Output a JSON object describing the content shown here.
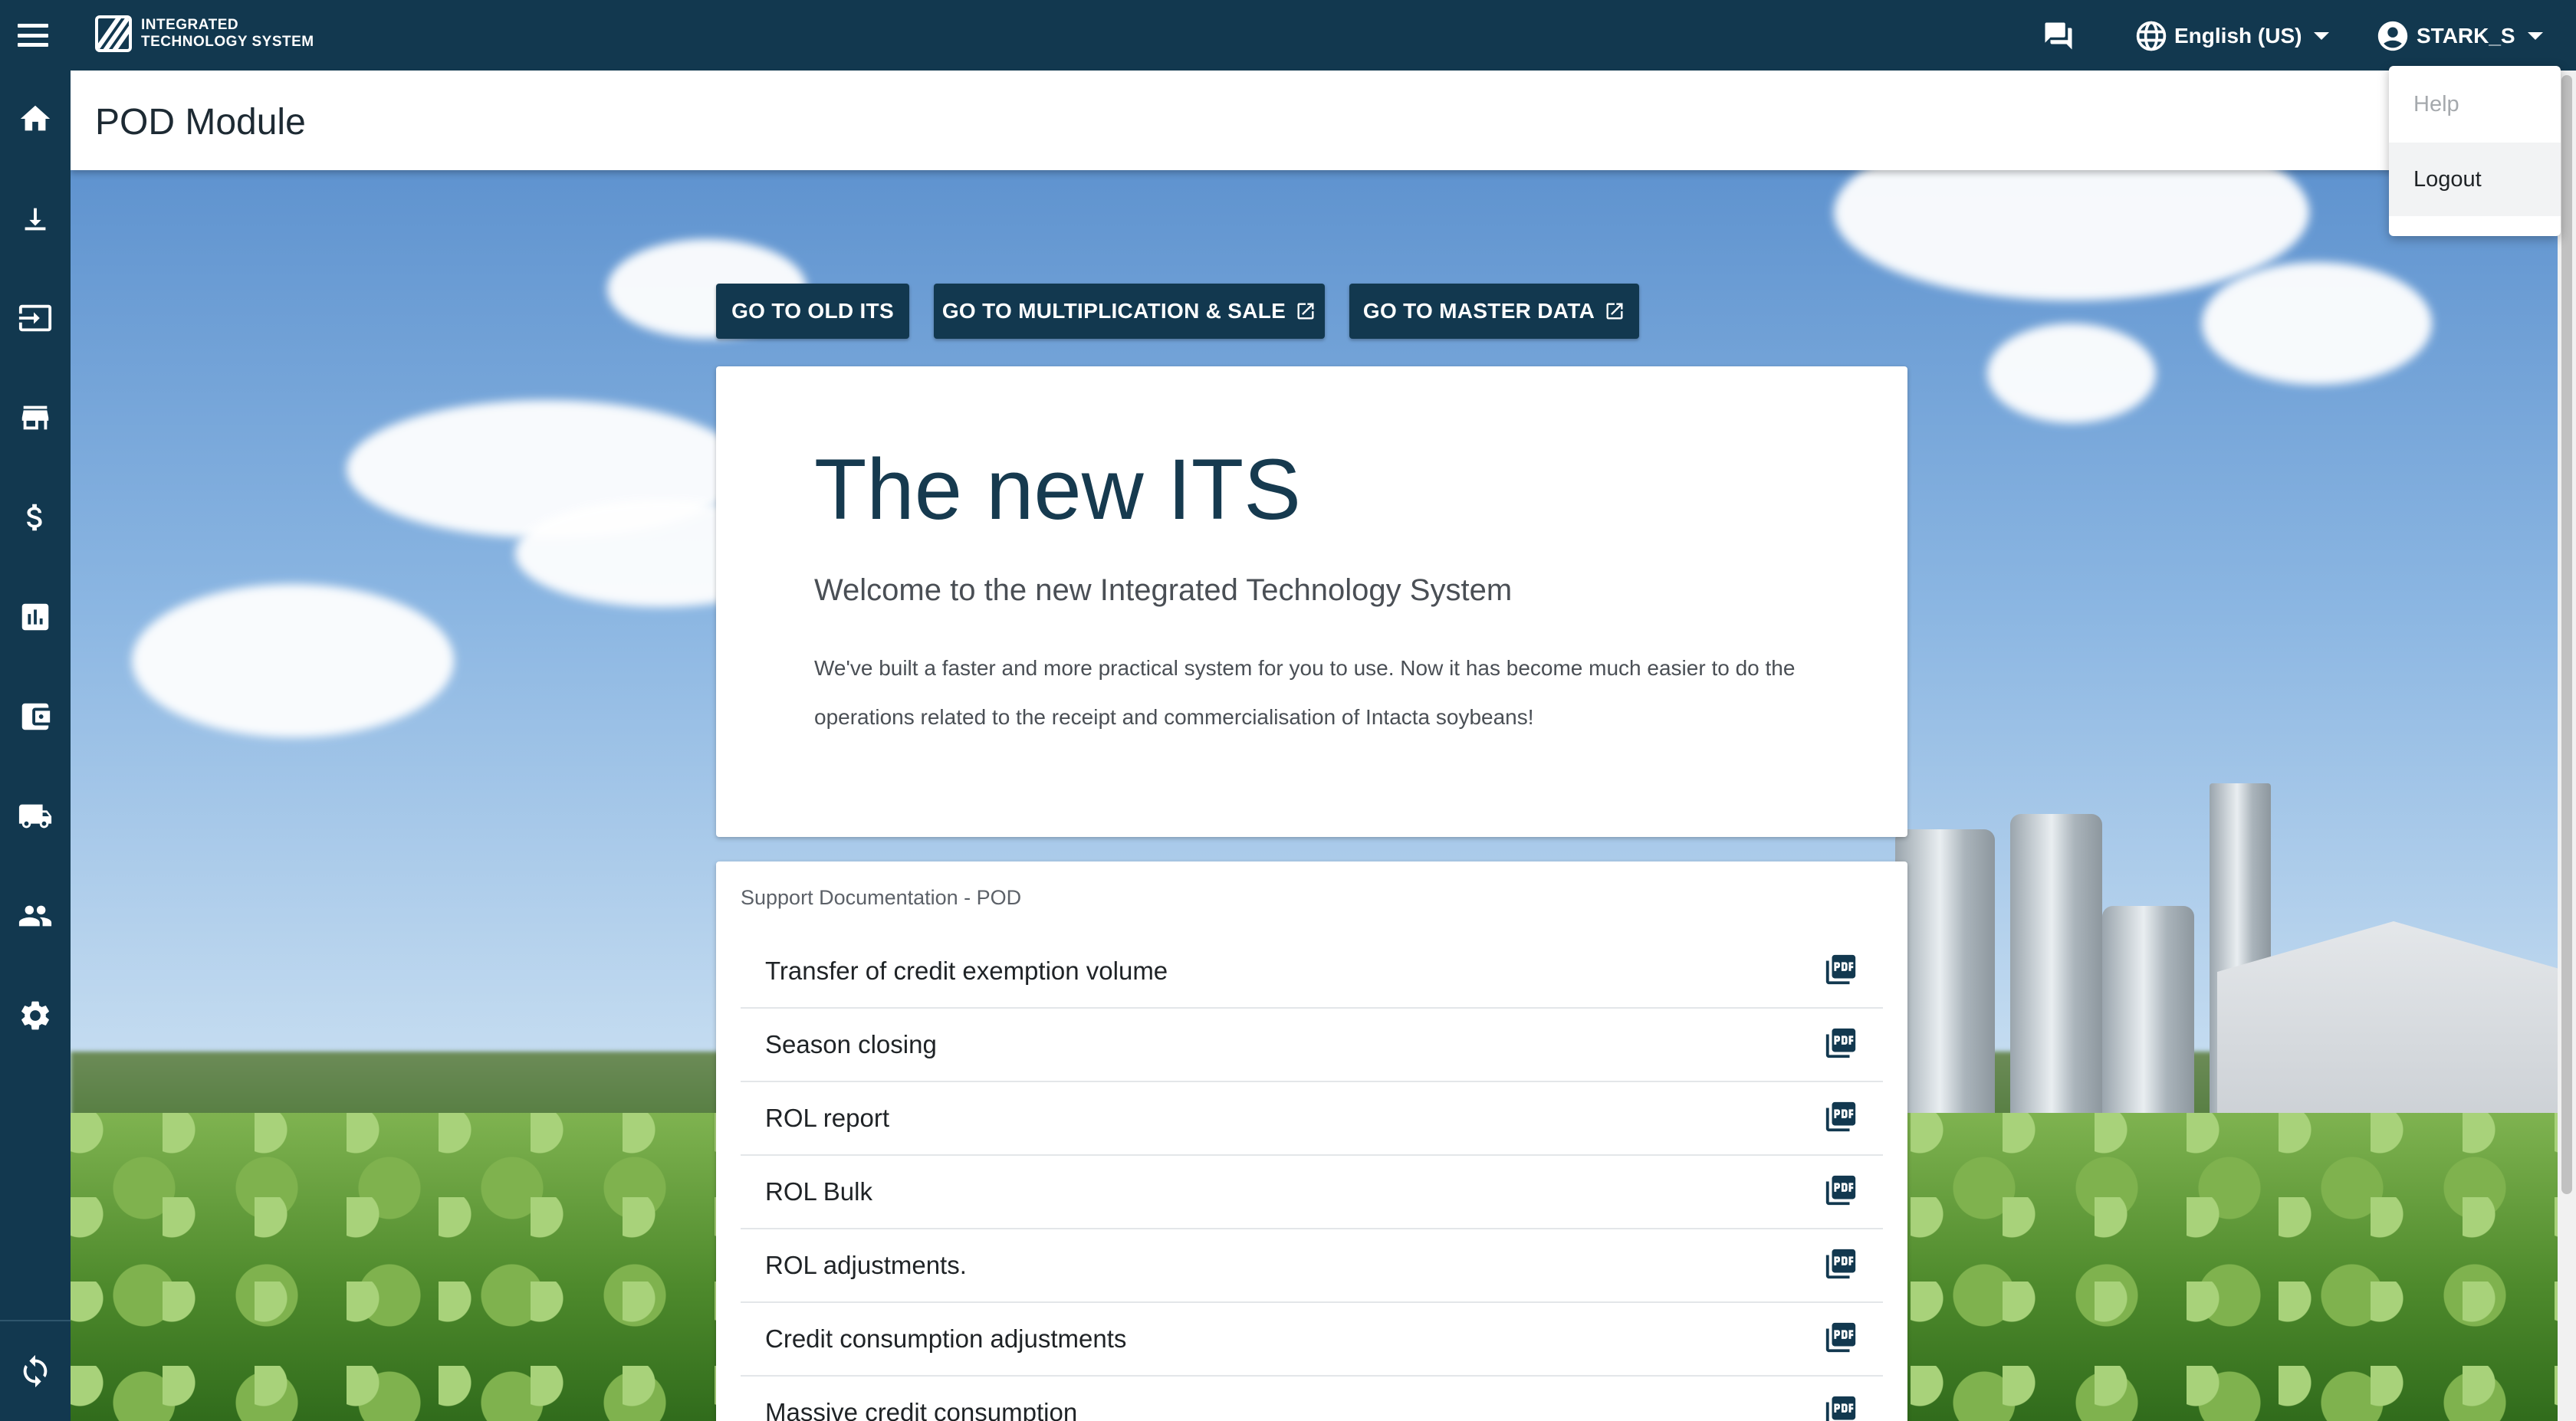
{
  "topbar": {
    "logo_line1": "INTEGRATED",
    "logo_line2": "TECHNOLOGY SYSTEM",
    "language": "English (US)",
    "username": "STARK_S",
    "icons": [
      "menu-icon",
      "chat-icon",
      "globe-icon",
      "account-circle-icon"
    ]
  },
  "sidebar": {
    "items": [
      {
        "icon": "home-icon"
      },
      {
        "icon": "download-icon"
      },
      {
        "icon": "input-icon"
      },
      {
        "icon": "store-icon"
      },
      {
        "icon": "dollar-icon"
      },
      {
        "icon": "bar-chart-icon"
      },
      {
        "icon": "wallet-icon"
      },
      {
        "icon": "truck-icon"
      },
      {
        "icon": "people-icon"
      },
      {
        "icon": "gear-icon"
      },
      {
        "icon": "sync-icon"
      }
    ]
  },
  "page": {
    "title": "POD Module"
  },
  "buttons": {
    "old_its": "GO TO OLD ITS",
    "multiplication_sale": "GO TO MULTIPLICATION & SALE",
    "master_data": "GO TO MASTER DATA"
  },
  "welcome": {
    "title": "The new ITS",
    "subtitle": "Welcome to the new Integrated Technology System",
    "body": "We've built a faster and more practical system for you to use. Now it has become much easier to do the operations related to the receipt and commercialisation of Intacta soybeans!"
  },
  "docs": {
    "heading": "Support Documentation - POD",
    "items": [
      "Transfer of credit exemption volume",
      "Season closing",
      "ROL report",
      "ROL Bulk",
      "ROL adjustments.",
      "Credit consumption adjustments",
      "Massive credit consumption"
    ]
  },
  "user_menu": {
    "help": "Help",
    "logout": "Logout"
  },
  "colors": {
    "primary": "#12384f",
    "title_text": "#163a4f"
  }
}
